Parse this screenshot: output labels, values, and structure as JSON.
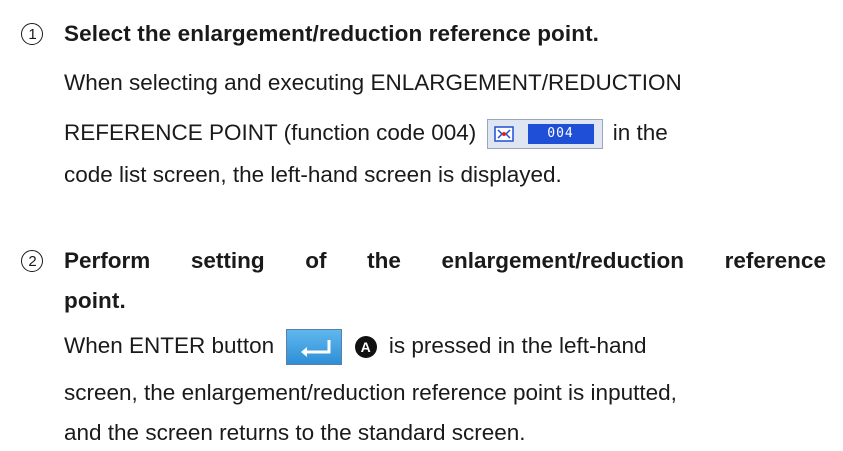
{
  "steps": [
    {
      "number": "1",
      "title": "Select the enlargement/reduction reference point.",
      "body": {
        "line1": "When selecting and executing ENLARGEMENT/REDUCTION",
        "line2_before": "REFERENCE POINT (function code 004)",
        "line2_after": "in the",
        "line3": "code list screen, the left-hand screen is displayed."
      },
      "icon": {
        "name": "enlargement-reduction-reference-point-icon",
        "code": "004"
      }
    },
    {
      "number": "2",
      "title_line1_words": [
        "Perform",
        "setting",
        "of",
        "the",
        "enlargement/reduction",
        "reference"
      ],
      "title_line2": "point.",
      "body": {
        "line1_before": "When ENTER button",
        "badge": "A",
        "line1_after": "is pressed in the left-hand",
        "line2": "screen, the enlargement/reduction reference point is inputted,",
        "line3": "and the screen returns to the standard screen."
      },
      "icon": {
        "name": "enter-icon"
      }
    }
  ],
  "colors": {
    "code_box": "#1f4fd6",
    "enter_button": "#2f8fd6",
    "text": "#1a1a1a"
  }
}
